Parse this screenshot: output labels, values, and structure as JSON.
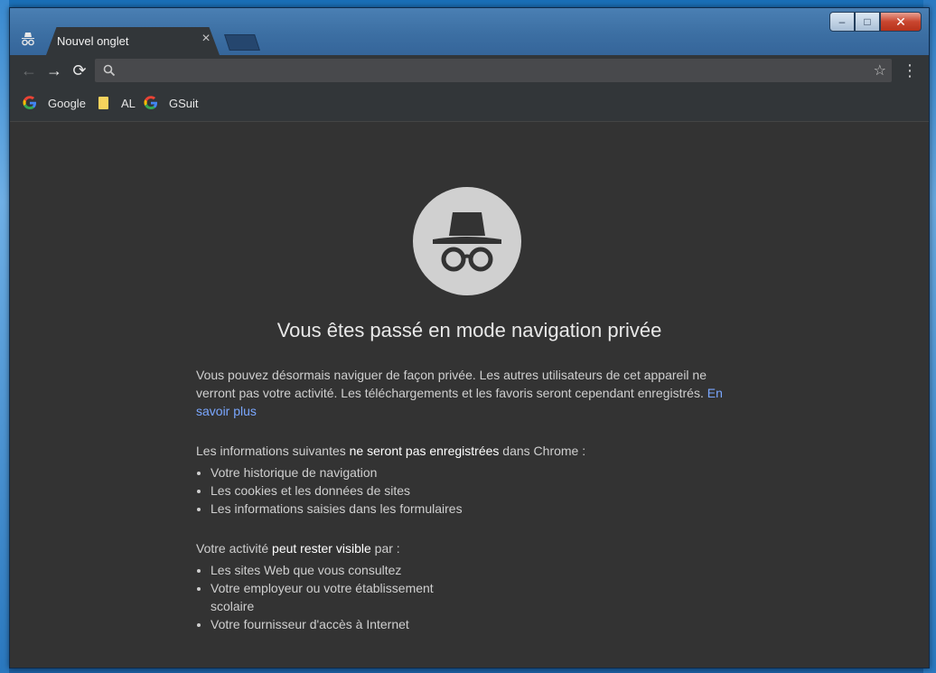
{
  "window": {
    "controls": {
      "minimize": "–",
      "maximize": "□",
      "close": "✕"
    }
  },
  "tab": {
    "title": "Nouvel onglet",
    "close": "×"
  },
  "toolbar": {
    "back": "←",
    "forward": "→",
    "reload": "⟳",
    "omnibox_value": "",
    "star": "☆",
    "menu": "⋮"
  },
  "bookmarks": [
    {
      "label": "Google",
      "icon": "google-icon"
    },
    {
      "label": "AL",
      "icon": "folder-icon"
    },
    {
      "label": "GSuit",
      "icon": "google-icon"
    }
  ],
  "incognito": {
    "headline": "Vous êtes passé en mode navigation privée",
    "intro": "Vous pouvez désormais naviguer de façon privée. Les autres utilisateurs de cet appareil ne verront pas votre activité. Les téléchargements et les favoris seront cependant enregistrés. ",
    "learn_more": "En savoir plus",
    "not_saved_prefix": "Les informations suivantes ",
    "not_saved_bold": "ne seront pas enregistrées",
    "not_saved_suffix": " dans Chrome :",
    "not_saved_items": [
      "Votre historique de navigation",
      "Les cookies et les données de sites",
      "Les informations saisies dans les formulaires"
    ],
    "visible_prefix": "Votre activité ",
    "visible_bold": "peut rester visible",
    "visible_suffix": " par :",
    "visible_items": [
      "Les sites Web que vous consultez",
      "Votre employeur ou votre établissement scolaire",
      "Votre fournisseur d'accès à Internet"
    ]
  },
  "colors": {
    "page_bg": "#333333",
    "toolbar_bg": "#323639",
    "link": "#7aa7ff",
    "icon_circle": "#d0d0d0"
  }
}
